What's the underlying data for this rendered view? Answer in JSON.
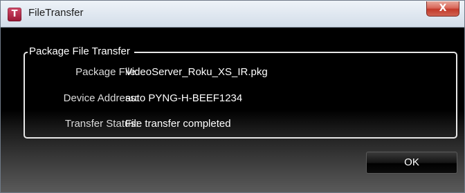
{
  "window": {
    "title": "FileTransfer",
    "app_icon_letter": "T",
    "close_glyph": "X"
  },
  "group": {
    "legend": "Package File Transfer",
    "rows": [
      {
        "label": "Package File:",
        "value": "VideoServer_Roku_XS_IR.pkg"
      },
      {
        "label": "Device Address:",
        "value": "auto PYNG-H-BEEF1234"
      },
      {
        "label": "Transfer Status:",
        "value": "File transfer completed"
      }
    ]
  },
  "buttons": {
    "ok_label": "OK"
  },
  "colors": {
    "app_icon": "#b8244a",
    "close_button": "#c2392a",
    "client_background": "#000000"
  }
}
